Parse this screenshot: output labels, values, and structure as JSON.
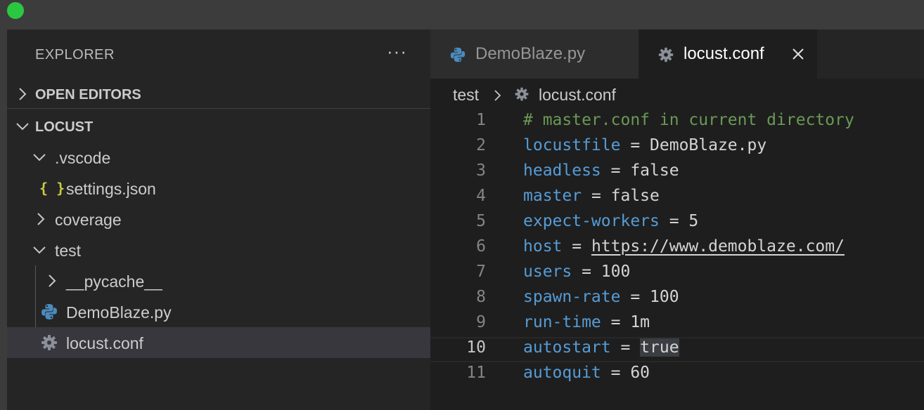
{
  "sidebar": {
    "title": "EXPLORER",
    "more_actions": "···",
    "sections": {
      "open_editors": "OPEN EDITORS",
      "project": "LOCUST"
    },
    "tree": [
      {
        "label": ".vscode",
        "kind": "folder",
        "expanded": true
      },
      {
        "label": "settings.json",
        "kind": "json",
        "icon": "{ }"
      },
      {
        "label": "coverage",
        "kind": "folder",
        "expanded": false
      },
      {
        "label": "test",
        "kind": "folder",
        "expanded": true
      },
      {
        "label": "__pycache__",
        "kind": "folder",
        "expanded": false
      },
      {
        "label": "DemoBlaze.py",
        "kind": "python"
      },
      {
        "label": "locust.conf",
        "kind": "config",
        "selected": true
      }
    ]
  },
  "tabs": [
    {
      "label": "DemoBlaze.py",
      "icon": "python-icon",
      "active": false
    },
    {
      "label": "locust.conf",
      "icon": "gear-icon",
      "active": true
    }
  ],
  "breadcrumb": {
    "folder": "test",
    "file": "locust.conf"
  },
  "code": {
    "current_line": 10,
    "lines": [
      {
        "n": "1",
        "comment": "# master.conf in current directory"
      },
      {
        "n": "2",
        "key": "locustfile",
        "op": " = ",
        "value": "DemoBlaze.py"
      },
      {
        "n": "3",
        "key": "headless",
        "op": " = ",
        "value": "false"
      },
      {
        "n": "4",
        "key": "master",
        "op": " = ",
        "value": "false"
      },
      {
        "n": "5",
        "key": "expect-workers",
        "op": " = ",
        "value": "5"
      },
      {
        "n": "6",
        "key": "host",
        "op": " = ",
        "value": "https://www.demoblaze.com/"
      },
      {
        "n": "7",
        "key": "users",
        "op": " = ",
        "value": "100"
      },
      {
        "n": "8",
        "key": "spawn-rate",
        "op": " = ",
        "value": "100"
      },
      {
        "n": "9",
        "key": "run-time",
        "op": " = ",
        "value": "1m"
      },
      {
        "n": "10",
        "key": "autostart",
        "op": " = ",
        "value": "true"
      },
      {
        "n": "11",
        "key": "autoquit",
        "op": " = ",
        "value": "60"
      }
    ]
  },
  "colors": {
    "comment": "#6a9955",
    "key": "#569cd6",
    "value": "#d4d4d4",
    "python_icon": "#4b8bbe",
    "json_icon": "#cbcb41",
    "gear_icon": "#8a8f98"
  }
}
